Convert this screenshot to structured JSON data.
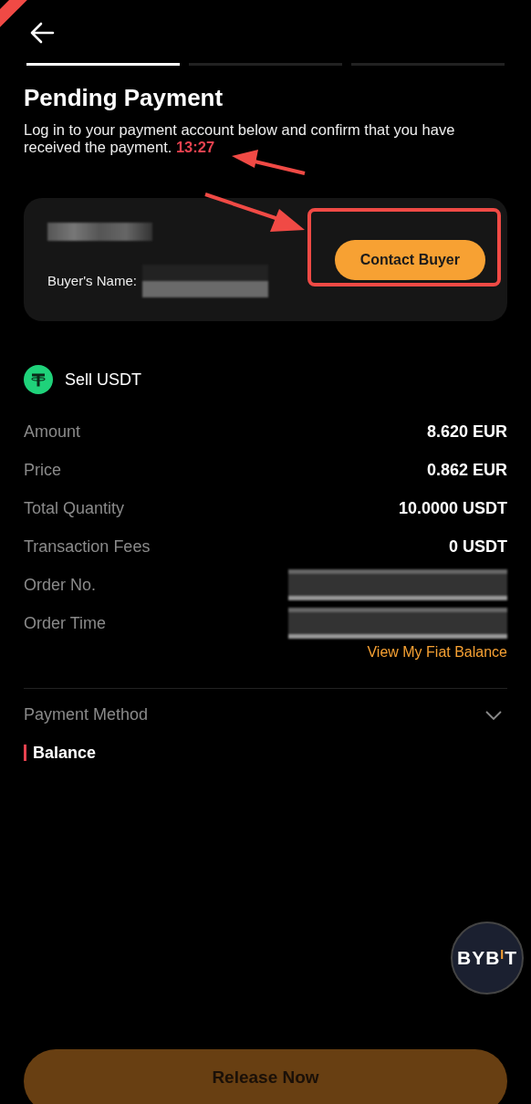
{
  "steps": [
    {
      "selected": true
    },
    {
      "selected": false
    },
    {
      "selected": false
    }
  ],
  "title": "Pending Payment",
  "description": "Log in to your payment account below and confirm that you have received the payment.",
  "timer": "13:27",
  "buyer_card": {
    "name": {
      "kind": "redacted"
    },
    "buyer_label": "Buyer's Name:",
    "buyer_value": {
      "kind": "redacted"
    },
    "contact_button": "Contact Buyer"
  },
  "trade": {
    "title": "Sell USDT"
  },
  "details": [
    {
      "label": "Amount",
      "kind": "text",
      "value": "8.620 EUR"
    },
    {
      "label": "Price",
      "kind": "text",
      "value": "0.862 EUR"
    },
    {
      "label": "Total Quantity",
      "kind": "text",
      "value": "10.0000 USDT"
    },
    {
      "label": "Transaction Fees",
      "kind": "text",
      "value": "0 USDT"
    },
    {
      "label": "Order No.",
      "kind": "redacted"
    },
    {
      "label": "Order Time",
      "kind": "redacted"
    }
  ],
  "fiat_link": "View My Fiat Balance",
  "payment_method": {
    "label": "Payment Method",
    "expanded": false,
    "method": "Balance"
  },
  "logo": {
    "before": "BYB",
    "accent": "I",
    "after": "T"
  },
  "release_button": {
    "label": "Release Now",
    "disabled": true
  }
}
